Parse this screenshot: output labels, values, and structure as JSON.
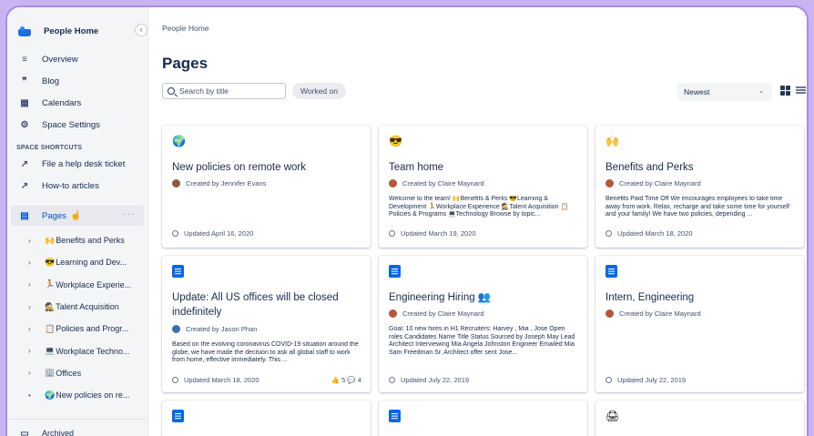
{
  "sidebar": {
    "space_title": "People Home",
    "collapse_glyph": "‹",
    "nav": [
      {
        "label": "Overview",
        "icon": "≡"
      },
      {
        "label": "Blog",
        "icon": "❞"
      },
      {
        "label": "Calendars",
        "icon": "▦"
      },
      {
        "label": "Space Settings",
        "icon": "⚙"
      }
    ],
    "shortcuts_label": "SPACE SHORTCUTS",
    "shortcuts": [
      {
        "label": "File a help desk ticket",
        "icon": "↗"
      },
      {
        "label": "How-to articles",
        "icon": "↗"
      }
    ],
    "pages_label": "Pages",
    "pages_icon": "▤",
    "pages_more": "···",
    "cursor_glyph": "☝",
    "tree": [
      {
        "emoji": "🙌",
        "label": "Benefits and Perks",
        "caret": "›"
      },
      {
        "emoji": "😎",
        "label": "Learning and Dev...",
        "caret": "›"
      },
      {
        "emoji": "🏃",
        "label": "Workplace Experie...",
        "caret": "›"
      },
      {
        "emoji": "🕵",
        "label": "Talent Acquisition",
        "caret": "›"
      },
      {
        "emoji": "📋",
        "label": "Policies and Progr...",
        "caret": "›"
      },
      {
        "emoji": "💻",
        "label": "Workplace Techno...",
        "caret": "›"
      },
      {
        "emoji": "🏢",
        "label": "Offices",
        "caret": "›"
      },
      {
        "emoji": "🌍",
        "label": "New policies on re...",
        "caret": "•"
      }
    ],
    "archived_label": "Archived",
    "archived_icon": "▭"
  },
  "main": {
    "breadcrumb": "People Home",
    "title": "Pages",
    "search_placeholder": "Search by title",
    "filter_chip": "Worked on",
    "sort_value": "Newest",
    "sort_chevron": "⌄"
  },
  "cards": [
    {
      "icon": "🌍",
      "title": "New policies on remote work",
      "author": "Created by Jennifer Evans",
      "avatar_color": "#8a5a3c",
      "excerpt": "",
      "updated": "Updated April 16, 2020",
      "stats": ""
    },
    {
      "icon": "😎",
      "title": "Team home",
      "author": "Created by Claire Maynard",
      "avatar_color": "#b5583a",
      "excerpt": "Welcome to the team! 🙌Benefits & Perks 😎Learning & Development 🏃Workplace Experience 🕵Talent Acquisition 📋Policies & Programs 💻Technology Browse by topic...",
      "updated": "Updated March 19, 2020",
      "stats": ""
    },
    {
      "icon": "🙌",
      "title": "Benefits and Perks",
      "author": "Created by Claire Maynard",
      "avatar_color": "#b5583a",
      "excerpt": "Benefits Paid Time Off We encourages employees to take time away from work. Relax, recharge and take some time for yourself and your family! We have two policies, depending ...",
      "updated": "Updated March 18, 2020",
      "stats": ""
    },
    {
      "icon": "doc",
      "title": "Update: All US offices will be closed indefinitely",
      "author": "Created by Jason Phan",
      "avatar_color": "#3d6fb0",
      "excerpt": "Based on the evolving coronavirus COVID-19 situation around the globe, we have made the decision to ask all global staff to work from home, effective immediately. This ...",
      "updated": "Updated March 18, 2020",
      "stats": "👍 5  💬 4"
    },
    {
      "icon": "doc",
      "title": "Engineering Hiring 👥",
      "author": "Created by Claire Maynard",
      "avatar_color": "#b5583a",
      "excerpt": "Goal: 10 new hires in H1 Recruiters: Harvey , Mia , Jose Open roles Candidates Name Title Status Sourced by Joseph May Lead Architect Interviewing Mia Angela Johnston Engineer Emailed Mia Sam Freedman Sr. Architect offer sent Jose...",
      "updated": "Updated July 22, 2019",
      "stats": ""
    },
    {
      "icon": "doc",
      "title": "Intern, Engineering",
      "author": "Created by Claire Maynard",
      "avatar_color": "#b5583a",
      "excerpt": "",
      "updated": "Updated July 22, 2019",
      "stats": ""
    },
    {
      "icon": "doc",
      "title": "",
      "author": "",
      "avatar_color": "",
      "excerpt": "",
      "updated": "",
      "stats": ""
    },
    {
      "icon": "doc",
      "title": "",
      "author": "",
      "avatar_color": "",
      "excerpt": "",
      "updated": "",
      "stats": ""
    },
    {
      "icon": "🖨",
      "title": "",
      "author": "",
      "avatar_color": "",
      "excerpt": "",
      "updated": "",
      "stats": ""
    }
  ]
}
